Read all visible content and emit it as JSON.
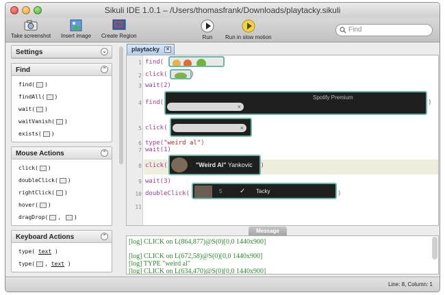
{
  "window": {
    "title": "Sikuli IDE 1.0.1 – /Users/thomasfrank/Downloads/playtacky.sikuli"
  },
  "toolbar": {
    "take_screenshot": "Take screenshot",
    "insert_image": "Insert image",
    "create_region": "Create Region",
    "run": "Run",
    "run_slow": "Run in slow motion",
    "search_placeholder": "Find"
  },
  "sidebar": {
    "settings": {
      "title": "Settings"
    },
    "find": {
      "title": "Find",
      "items": [
        "find(",
        "findAll(",
        "wait(",
        "waitVanish(",
        "exists("
      ]
    },
    "mouse": {
      "title": "Mouse Actions",
      "items": [
        "click(",
        "doubleClick(",
        "rightClick(",
        "hover(",
        "dragDrop("
      ]
    },
    "keyboard": {
      "title": "Keyboard Actions",
      "items": [
        "type(",
        "text",
        "type(",
        "text"
      ]
    }
  },
  "editor": {
    "tab_label": "playtacky",
    "lines": {
      "l1": "find(",
      "l1b": ")",
      "l2": "click(",
      "l2b": ")",
      "l3": "wait(2)",
      "l4": "find(",
      "l4b": ")",
      "l4_thumb": "Spotify Premium",
      "l5": "click(",
      "l5b": ")",
      "l6a": "type(",
      "l6s": "\"weird al\"",
      "l6b": ")",
      "l7": "wait(1)",
      "l8": "click(",
      "l8b": ")",
      "l8_thumb_bold": "\"Weird Al\"",
      "l8_thumb_rest": " Yankovic",
      "l9": "wait(3)",
      "l10": "doubleClick(",
      "l10b": ")",
      "l10_thumb_num": "5",
      "l10_thumb_check": "✓",
      "l10_thumb_text": "Tacky"
    },
    "line_numbers": [
      "1",
      "2",
      "3",
      "4",
      "5",
      "6",
      "7",
      "8",
      "9",
      "10",
      "11"
    ]
  },
  "message": {
    "tab_label": "Message",
    "logs": [
      "[log] CLICK on L(864,877)@S(0)[0,0 1440x900]",
      "[log] CLICK on L(672,58)@S(0)[0,0 1440x900]",
      "[log] TYPE \"weird al\"",
      "[log] CLICK on L(634,470)@S(0)[0,0 1440x900]"
    ]
  },
  "status": {
    "position": "Line: 8, Column: 1"
  },
  "colors": {
    "thumb_border": "#6bb7a6",
    "log_text": "#2a8a2a",
    "keyword": "#a33a9a",
    "string": "#b3211e"
  }
}
